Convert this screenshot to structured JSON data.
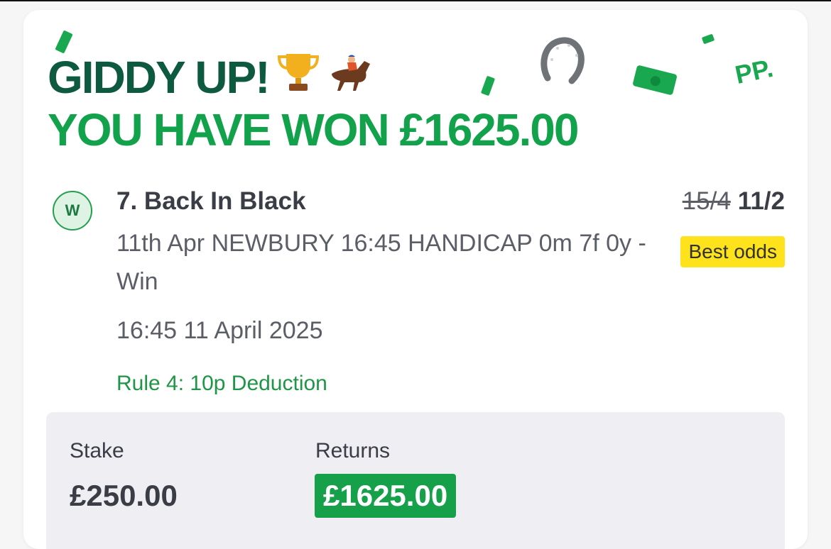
{
  "header": {
    "line1": "GIDDY UP!",
    "line2": "YOU HAVE WON £1625.00",
    "brand_mark": "PP.",
    "trophy_emoji": "🏆",
    "horse_emoji": "🏇"
  },
  "bet": {
    "result_badge": "W",
    "selection": "7. Back In Black",
    "event": "11th Apr NEWBURY 16:45 HANDICAP 0m 7f 0y - Win",
    "time": "16:45 11 April 2025",
    "rule4": "Rule 4: 10p Deduction",
    "odds_old": "15/4",
    "odds_new": "11/2",
    "best_odds_label": "Best odds"
  },
  "summary": {
    "stake_label": "Stake",
    "stake_value": "£250.00",
    "returns_label": "Returns",
    "returns_value": "£1625.00"
  },
  "colors": {
    "dark_green": "#0e5a41",
    "brand_green": "#12a24b",
    "best_odds_yellow": "#fde21c",
    "summary_bg": "#eeeef3"
  },
  "decorations": [
    "money-note-icon",
    "horseshoe-icon",
    "money-note-icon",
    "money-note-icon",
    "money-note-icon"
  ]
}
